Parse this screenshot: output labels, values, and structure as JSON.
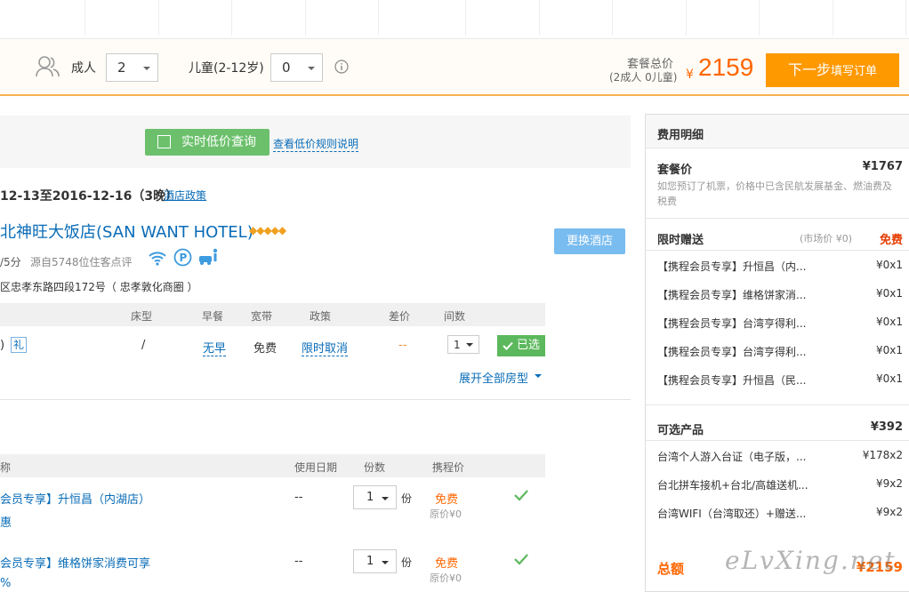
{
  "booking_bar": {
    "adult_label": "成人",
    "adult_value": "2",
    "child_label": "儿童(2-12岁)",
    "child_value": "0",
    "total_label": "套餐总价",
    "total_sub": "(2成人 0儿童)",
    "currency": "¥",
    "total_price": "2159",
    "next_button_main": "下一步",
    "next_button_sub": "填写订单"
  },
  "lowprice": {
    "checkbox_label": "实时低价查询",
    "rule_link": "查看低价规则说明"
  },
  "hotel": {
    "dates": "12-13至2016-12-16（3晚）",
    "policy_link": "酒店政策",
    "name": "北神旺大饭店(SAN WANT HOTEL)",
    "rating": "/5分",
    "reviews": "源自5748位住客点评",
    "address": "区忠孝东路四段172号（ 忠孝敦化商圈 ）",
    "change_button": "更换酒店",
    "table_headers": [
      "床型",
      "早餐",
      "宽带",
      "政策",
      "差价",
      "间数"
    ],
    "room": {
      "prefix": ")",
      "gift": "礼",
      "bed": "/",
      "breakfast": "无早",
      "broadband": "免费",
      "policy": "限时取消",
      "diff": "--",
      "rooms": "1",
      "selected": "已选"
    },
    "expand_link": "展开全部房型"
  },
  "products": {
    "headers": [
      "称",
      "使用日期",
      "份数",
      "携程价"
    ],
    "items": [
      {
        "name": "会员专享】升恒昌（内湖店）",
        "sub": "惠",
        "date": "--",
        "qty": "1",
        "unit": "份",
        "price": "免费",
        "orig": "原价¥0"
      },
      {
        "name": "会员专享】维格饼家消费可享",
        "sub": "%",
        "date": "--",
        "qty": "1",
        "unit": "份",
        "price": "免费",
        "orig": "原价¥0"
      }
    ]
  },
  "fees": {
    "title": "费用明细",
    "package_label": "套餐价",
    "package_value": "¥1767",
    "package_note": "如您预订了机票，价格中已含民航发展基金、燃油费及税费",
    "gift_label": "限时赠送",
    "gift_market": "(市场价 ¥0)",
    "gift_free": "免费",
    "gifts": [
      {
        "name": "【携程会员专享】升恒昌（内...",
        "qty": "¥0x1"
      },
      {
        "name": "【携程会员专享】维格饼家消...",
        "qty": "¥0x1"
      },
      {
        "name": "【携程会员专享】台湾亨得利...",
        "qty": "¥0x1"
      },
      {
        "name": "【携程会员专享】台湾亨得利...",
        "qty": "¥0x1"
      },
      {
        "name": "【携程会员专享】升恒昌（民...",
        "qty": "¥0x1"
      }
    ],
    "optional_label": "可选产品",
    "optional_value": "¥392",
    "optional": [
      {
        "name": "台湾个人游入台证（电子版，...",
        "qty": "¥178x2"
      },
      {
        "name": "台北拼车接机+台北/高雄送机...",
        "qty": "¥9x2"
      },
      {
        "name": "台湾WIFI（台湾取还）+赠送...",
        "qty": "¥9x2"
      }
    ],
    "total_label": "总额",
    "total_value": "¥2159"
  },
  "watermark": "eLvXing.net",
  "colors": {
    "accent": "#ff6600",
    "button": "#ff9900",
    "link": "#0a6cb7",
    "green": "#5cb85c",
    "lightblue": "#79bcef"
  }
}
